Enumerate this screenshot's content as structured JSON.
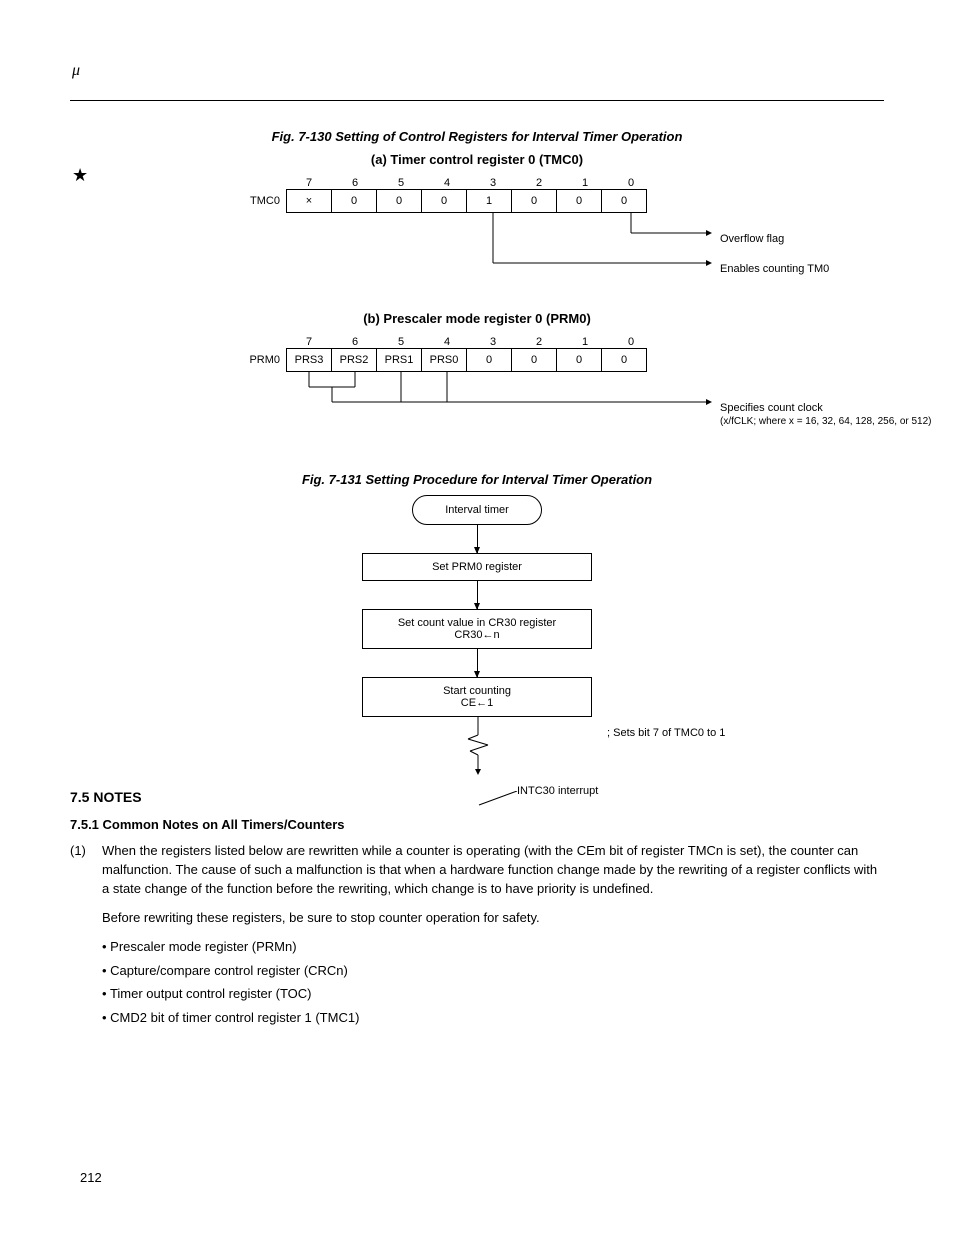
{
  "header": {
    "mu": "μ",
    "star": "★"
  },
  "fig_a": {
    "caption": "Fig. 7-130  Setting of Control Registers for Interval Timer Operation",
    "subcaption": "(a)  Timer control register 0 (TMC0)",
    "bitnums": [
      "7",
      "6",
      "5",
      "4",
      "3",
      "2",
      "1",
      "0"
    ],
    "label": "TMC0",
    "cells": [
      "×",
      "0",
      "0",
      "0",
      "1",
      "0",
      "0",
      "0"
    ],
    "callout1": "Overflow flag",
    "callout2": "Enables counting TM0"
  },
  "fig_b": {
    "subcaption": "(b)  Prescaler mode register 0 (PRM0)",
    "bitnums": [
      "7",
      "6",
      "5",
      "4",
      "3",
      "2",
      "1",
      "0"
    ],
    "label": "PRM0",
    "cells": [
      "PRS3",
      "PRS2",
      "PRS1",
      "PRS0",
      "0",
      "0",
      "0",
      "0"
    ],
    "callout": "Specifies count clock",
    "callout_sub": "(x/fCLK; where x = 16, 32, 64, 128, 256, or 512)"
  },
  "fig_flow": {
    "caption": "Fig. 7-131  Setting Procedure for Interval Timer Operation",
    "start": "Interval timer",
    "step1": "Set PRM0 register",
    "step2a": "Set count value in CR30 register",
    "step2b": "CR30←n",
    "step3a": "Start counting",
    "step3b": "CE←1",
    "note3": "; Sets bit 7 of TMC0 to 1",
    "interrupt": "INTC30 interrupt"
  },
  "notes": {
    "h": "7.5  NOTES",
    "sub_h": "7.5.1  Common Notes on All Timers/Counters",
    "item_num": "(1)",
    "item_text": "When the registers listed below are rewritten while a counter is operating (with the CEm bit of register TMCn is set), the counter can malfunction.  The cause of such a malfunction is that when a hardware function change made by the rewriting of a register conflicts with a state change of the function before the rewriting, which change is to have priority is undefined.",
    "item_text2": "Before rewriting these registers, be sure to stop counter operation for safety.",
    "bullets": [
      "Prescaler mode register (PRMn)",
      "Capture/compare control register (CRCn)",
      "Timer output control register (TOC)",
      "CMD2 bit of timer control register 1 (TMC1)"
    ]
  },
  "page": "212",
  "chart_data": [
    {
      "type": "table",
      "title": "TMC0 register bits",
      "categories": [
        "7",
        "6",
        "5",
        "4",
        "3",
        "2",
        "1",
        "0"
      ],
      "values": [
        "×",
        "0",
        "0",
        "0",
        "1",
        "0",
        "0",
        "0"
      ]
    },
    {
      "type": "table",
      "title": "PRM0 register bits",
      "categories": [
        "7",
        "6",
        "5",
        "4",
        "3",
        "2",
        "1",
        "0"
      ],
      "values": [
        "PRS3",
        "PRS2",
        "PRS1",
        "PRS0",
        "0",
        "0",
        "0",
        "0"
      ]
    }
  ]
}
